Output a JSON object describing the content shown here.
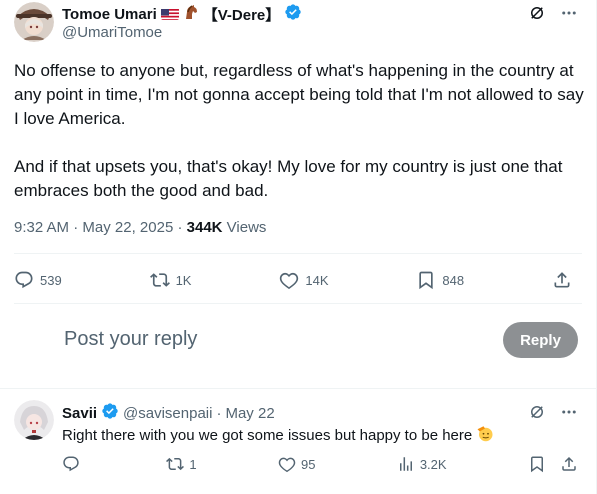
{
  "post": {
    "author_name": "Tomoe Umari",
    "author_tag": "【V-Dere】",
    "handle": "@UmariTomoe",
    "paragraphs": [
      "No offense to anyone but, regardless of what's happening in the country at any point in time, I'm not gonna accept being told that I'm not allowed to say I love America.",
      "And if that upsets you, that's okay! My love for my country is just one that embraces both the good and bad."
    ],
    "time": "9:32 AM",
    "date": "May 22, 2025",
    "views_count": "344K",
    "views_label": "Views",
    "replies": "539",
    "reposts": "1K",
    "likes": "14K",
    "bookmarks": "848"
  },
  "composer": {
    "placeholder": "Post your reply",
    "reply_button": "Reply"
  },
  "reply": {
    "author_name": "Savii",
    "handle": "@savisenpaii",
    "date": "May 22",
    "text": "Right there with you we got some issues but happy to be here",
    "replies": "",
    "reposts": "1",
    "likes": "95",
    "views": "3.2K"
  },
  "colors": {
    "verified": "#1d9bf0",
    "muted": "#536471",
    "reply_button_bg": "#8d9093"
  }
}
